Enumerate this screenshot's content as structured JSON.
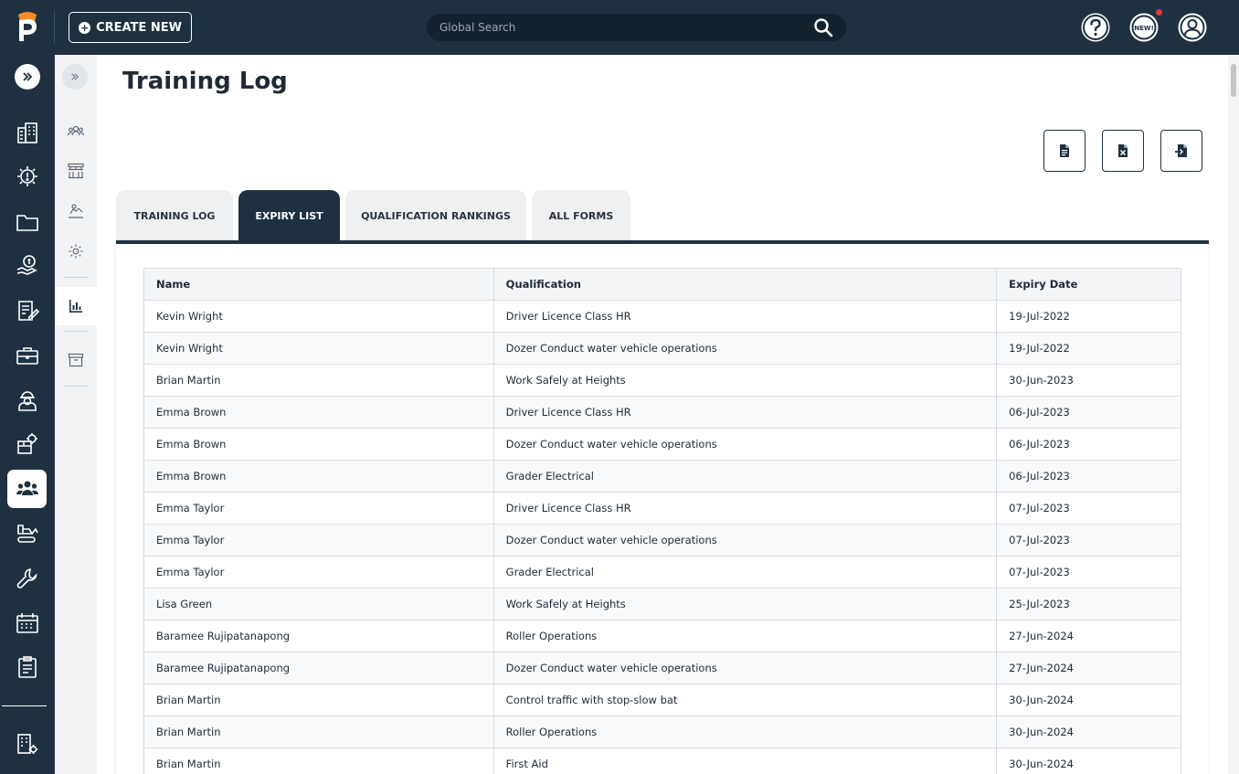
{
  "header": {
    "create_label": "CREATE NEW",
    "search_placeholder": "Global Search"
  },
  "colors": {
    "navy": "#1f3141",
    "accent": "#f28c28",
    "badge": "#e23b3b"
  },
  "page": {
    "title": "Training Log"
  },
  "tabs": [
    {
      "label": "TRAINING LOG",
      "active": false
    },
    {
      "label": "EXPIRY LIST",
      "active": true
    },
    {
      "label": "QUALIFICATION RANKINGS",
      "active": false
    },
    {
      "label": "ALL FORMS",
      "active": false
    }
  ],
  "table": {
    "headers": [
      "Name",
      "Qualification",
      "Expiry Date"
    ],
    "rows": [
      [
        "Kevin Wright",
        "Driver Licence Class HR",
        "19-Jul-2022"
      ],
      [
        "Kevin Wright",
        "Dozer Conduct water vehicle operations",
        "19-Jul-2022"
      ],
      [
        "Brian Martin",
        "Work Safely at Heights",
        "30-Jun-2023"
      ],
      [
        "Emma Brown",
        "Driver Licence Class HR",
        "06-Jul-2023"
      ],
      [
        "Emma Brown",
        "Dozer Conduct water vehicle operations",
        "06-Jul-2023"
      ],
      [
        "Emma Brown",
        "Grader Electrical",
        "06-Jul-2023"
      ],
      [
        "Emma Taylor",
        "Driver Licence Class HR",
        "07-Jul-2023"
      ],
      [
        "Emma Taylor",
        "Dozer Conduct water vehicle operations",
        "07-Jul-2023"
      ],
      [
        "Emma Taylor",
        "Grader Electrical",
        "07-Jul-2023"
      ],
      [
        "Lisa Green",
        "Work Safely at Heights",
        "25-Jul-2023"
      ],
      [
        "Baramee Rujipatanapong",
        "Roller Operations",
        "27-Jun-2024"
      ],
      [
        "Baramee Rujipatanapong",
        "Dozer Conduct water vehicle operations",
        "27-Jun-2024"
      ],
      [
        "Brian Martin",
        "Control traffic with stop-slow bat",
        "30-Jun-2024"
      ],
      [
        "Brian Martin",
        "Roller Operations",
        "30-Jun-2024"
      ],
      [
        "Brian Martin",
        "First Aid",
        "30-Jun-2024"
      ]
    ]
  }
}
